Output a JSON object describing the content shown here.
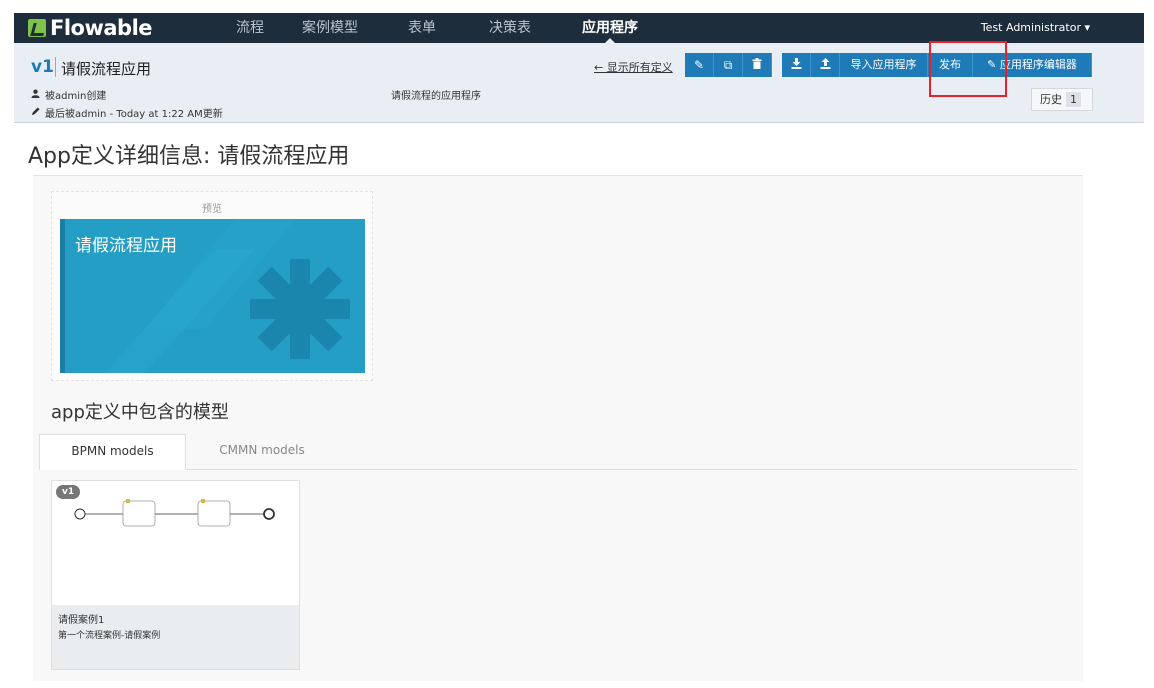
{
  "nav": {
    "logo": "Flowable",
    "items": [
      {
        "label": "流程"
      },
      {
        "label": "案例模型"
      },
      {
        "label": "表单"
      },
      {
        "label": "决策表"
      },
      {
        "label": "应用程序"
      }
    ],
    "active": "应用程序",
    "user": "Test Administrator ▾"
  },
  "header": {
    "version": "v1",
    "app_name": "请假流程应用",
    "created_by": "被admin创建",
    "updated_by": "最后被admin - Today at 1:22 AM更新",
    "description": "请假流程的应用程序",
    "back_link": "← 显示所有定义",
    "toolbar": {
      "edit_icon": "✎",
      "copy_icon": "⧉",
      "delete_icon": "🗑",
      "export_icon": "⤓",
      "export_deploy_icon": "⤒",
      "import_label": "导入应用程序",
      "publish_label": "发布",
      "editor_icon": "✎",
      "editor_label": "应用程序编辑器"
    },
    "history_label": "历史",
    "history_count": "1"
  },
  "page": {
    "title": "App定义详细信息: 请假流程应用",
    "preview_label": "预览",
    "tile_title": "请假流程应用",
    "models_section": "app定义中包含的模型"
  },
  "tabs": [
    {
      "label": "BPMN models",
      "active": true
    },
    {
      "label": "CMMN models",
      "active": false
    }
  ],
  "model_card": {
    "badge": "v1",
    "name": "请假案例1",
    "description": "第一个流程案例-请假案例"
  },
  "colors": {
    "nav_bg": "#1e2d3b",
    "accent": "#1f7ab8",
    "tile_bg": "#249ec4",
    "highlight": "#e8212b"
  }
}
